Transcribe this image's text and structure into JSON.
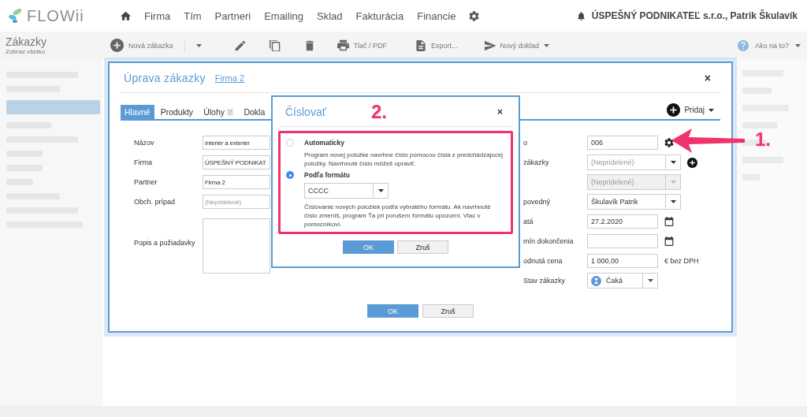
{
  "app": {
    "logo": "FLOWii"
  },
  "nav": {
    "items": [
      "Firma",
      "Tím",
      "Partneri",
      "Emailing",
      "Sklad",
      "Fakturácia",
      "Financie"
    ],
    "account": "ÚSPEŠNÝ PODNIKATEĽ s.r.o., Patrik Škulavík"
  },
  "toolbar": {
    "section_title": "Zákazky",
    "section_subtitle": "Zobraz všetko",
    "new_button": "Nová zákazka",
    "print_button": "Tlač / PDF",
    "export_button": "Export...",
    "document_button": "Nový doklad",
    "help_link": "Ako na to?"
  },
  "edit_dialog": {
    "title": "Úprava zákazky",
    "company_link": "Firma 2",
    "close": "×",
    "tabs": [
      {
        "label": "Hlavné",
        "selected": true
      },
      {
        "label": "Produkty",
        "selected": false
      },
      {
        "label": "Úlohy",
        "badge": "7",
        "selected": false
      },
      {
        "label": "Dokla",
        "selected": false
      }
    ],
    "add_button": "Pridaj",
    "left_fields": [
      {
        "kind": "text",
        "label": "Názov",
        "value": "Interiér a exteriér"
      },
      {
        "kind": "text",
        "label": "Firma",
        "value": "ÚSPEŠNÝ PODNIKAT"
      },
      {
        "kind": "text",
        "label": "Partner",
        "value": "Firma 2"
      },
      {
        "kind": "text",
        "label": "Obch. prípad",
        "placeholder": "(Nepridelené)"
      },
      {
        "kind": "textarea",
        "label": "Popis a požiadavky"
      }
    ],
    "right_fields": [
      {
        "kind": "number",
        "label": "o",
        "value": "006",
        "disabled": false
      },
      {
        "kind": "select-add",
        "label": "zákazky",
        "placeholder": "(Nepridelené)",
        "disabled": false
      },
      {
        "kind": "select",
        "placeholder": "(Nepridelené)",
        "disabled": true
      },
      {
        "kind": "select",
        "label": "povedný",
        "value": "Škulavík Patrik",
        "disabled": false
      },
      {
        "kind": "date",
        "label": "atá",
        "value": "27.2.2020",
        "disabled": false
      },
      {
        "kind": "date",
        "label": "mín dokončenia",
        "disabled": false
      },
      {
        "kind": "price",
        "label": "odnutá cena",
        "value": "1 000,00",
        "suffix": "€ bez DPH",
        "disabled": false
      },
      {
        "kind": "status",
        "label": "Stav zákazky",
        "value": "Čaká",
        "disabled": false
      }
    ],
    "buttons": {
      "ok": "OK",
      "cancel": "Zruš"
    }
  },
  "numbering_dialog": {
    "title": "Číslovať",
    "close": "×",
    "options": [
      {
        "label": "Automaticky",
        "description": "Program novej položke navrhne číslo pomocou čísla z predchádzajúcej položky. Navrhnuté číslo môžeš upraviť.",
        "selected": false
      },
      {
        "label": "Podľa formátu",
        "format": "CCCC",
        "description": "Číslovanie nových položiek podľa vybratého formátu. Ak navrhnuté číslo zmeníš, program Ťa pri porušení formátu upozorní. Viac v pomocníkovi.",
        "selected": true
      }
    ],
    "buttons": {
      "ok": "OK",
      "cancel": "Zruš"
    }
  },
  "annotations": {
    "step_1": "1.",
    "step_2": "2."
  }
}
